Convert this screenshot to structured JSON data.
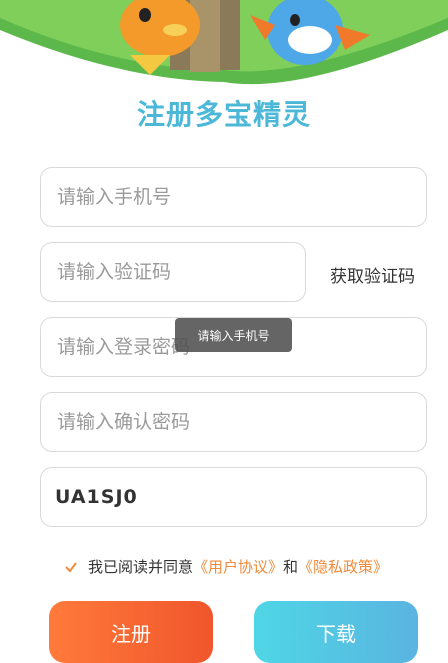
{
  "title": "注册多宝精灵",
  "form": {
    "phone_placeholder": "请输入手机号",
    "code_placeholder": "请输入验证码",
    "get_code_label": "获取验证码",
    "password_placeholder": "请输入登录密码",
    "confirm_placeholder": "请输入确认密码",
    "captcha_text": "UA1SJ0"
  },
  "toast": "请输入手机号",
  "agreement": {
    "prefix": "我已阅读并同意",
    "user_agreement": "《用户协议》",
    "conjunction": "和",
    "privacy_policy": "《隐私政策》",
    "checked": true
  },
  "buttons": {
    "register": "注册",
    "download": "下载"
  },
  "colors": {
    "title": "#4cb8d8",
    "link": "#f08a3c",
    "register_start": "#ff7a3a",
    "register_end": "#f0562c",
    "download_start": "#4fd6e6",
    "download_end": "#5ab4e0"
  }
}
